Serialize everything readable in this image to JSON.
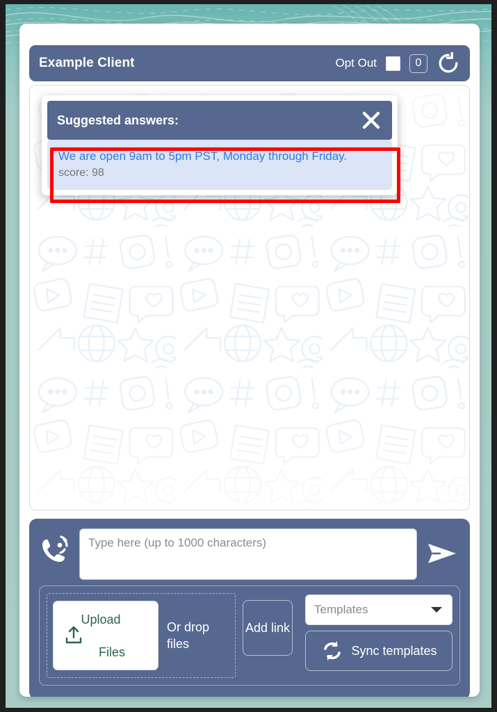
{
  "header": {
    "client_name": "Example Client",
    "opt_out_label": "Opt Out",
    "opt_out_checked": false,
    "count_badge": "0",
    "refresh_icon": "refresh-icon"
  },
  "suggested": {
    "title": "Suggested answers:",
    "close_icon": "close-icon",
    "items": [
      {
        "text": "We are open 9am to 5pm PST, Monday through Friday.",
        "score_label": "score: 98"
      }
    ]
  },
  "composer": {
    "phone_icon": "phone-call-icon",
    "input_placeholder": "Type here (up to 1000 characters)",
    "input_value": "",
    "send_icon": "send-icon",
    "upload": {
      "icon": "upload-icon",
      "label_line1": "Upload",
      "label_line2": "Files",
      "drop_hint": "Or drop files"
    },
    "add_link_label": "Add link",
    "templates": {
      "placeholder": "Templates",
      "caret_icon": "chevron-down-icon"
    },
    "sync": {
      "label": "Sync templates",
      "icon": "sync-icon"
    }
  },
  "colors": {
    "slate": "#56688f",
    "page_teal": "#a8cdc7",
    "suggestion_bg": "#dbe5f7",
    "suggestion_text": "#2e7ae0",
    "upload_green": "#2d6152",
    "annotation_red": "#ff0000"
  }
}
